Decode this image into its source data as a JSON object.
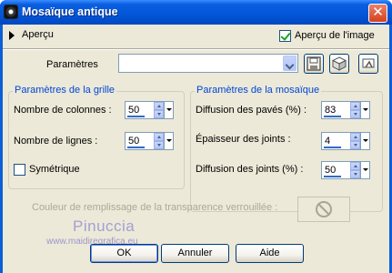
{
  "window": {
    "title": "Mosaïque antique"
  },
  "preview": {
    "toggle_label": "Aperçu",
    "image_preview_label": "Aperçu de l'image",
    "image_preview_checked": true
  },
  "params": {
    "label": "Paramètres",
    "preset_value": ""
  },
  "toolbar": {
    "save_icon": "save-icon",
    "randomize_icon": "dice-icon",
    "reset_icon": "reset-icon"
  },
  "grid": {
    "title": "Paramètres de la grille",
    "columns_label": "Nombre de colonnes :",
    "columns_value": "50",
    "rows_label": "Nombre de lignes :",
    "rows_value": "50",
    "symmetric_label": "Symétrique",
    "symmetric_checked": false
  },
  "mosaic": {
    "title": "Paramètres de la mosaïque",
    "tile_diffusion_label": "Diffusion des pavés (%) :",
    "tile_diffusion_value": "83",
    "joint_thickness_label": "Épaisseur des joints :",
    "joint_thickness_value": "4",
    "joint_diffusion_label": "Diffusion des joints (%) :",
    "joint_diffusion_value": "50"
  },
  "fill": {
    "label": "Couleur de remplissage de la transparence verrouillée :"
  },
  "watermark": {
    "name": "Pinuccia",
    "url": "www.maidiregrafica.eu"
  },
  "buttons": {
    "ok": "OK",
    "cancel": "Annuler",
    "help": "Aide"
  }
}
